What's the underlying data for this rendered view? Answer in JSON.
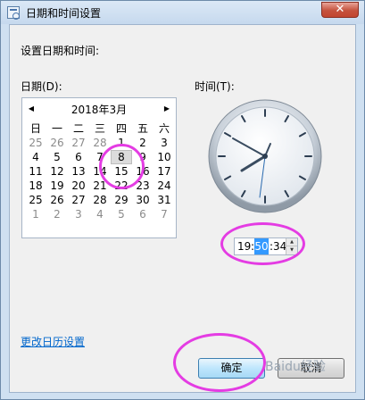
{
  "window": {
    "title": "日期和时间设置",
    "close_label": "✕"
  },
  "content": {
    "heading": "设置日期和时间:",
    "date_label": "日期(D):",
    "time_label": "时间(T):"
  },
  "calendar": {
    "prev_label": "◀",
    "next_label": "▶",
    "month_title": "2018年3月",
    "weekdays": [
      "日",
      "一",
      "二",
      "三",
      "四",
      "五",
      "六"
    ],
    "weeks": [
      [
        "25",
        "26",
        "27",
        "28",
        "1",
        "2",
        "3"
      ],
      [
        "4",
        "5",
        "6",
        "7",
        "8",
        "9",
        "10"
      ],
      [
        "11",
        "12",
        "13",
        "14",
        "15",
        "16",
        "17"
      ],
      [
        "18",
        "19",
        "20",
        "21",
        "22",
        "23",
        "24"
      ],
      [
        "25",
        "26",
        "27",
        "28",
        "29",
        "30",
        "31"
      ],
      [
        "1",
        "2",
        "3",
        "4",
        "5",
        "6",
        "7"
      ]
    ],
    "selected_day": "8"
  },
  "time": {
    "hour": "19",
    "minute": "50",
    "second": "34",
    "separator": ":"
  },
  "links": {
    "change_calendar": "更改日历设置"
  },
  "buttons": {
    "ok": "确定",
    "cancel": "取消"
  },
  "watermark": "Baidu经验",
  "colors": {
    "annotation": "#e43ce3",
    "selection": "#3399ff",
    "link": "#0066cc"
  }
}
